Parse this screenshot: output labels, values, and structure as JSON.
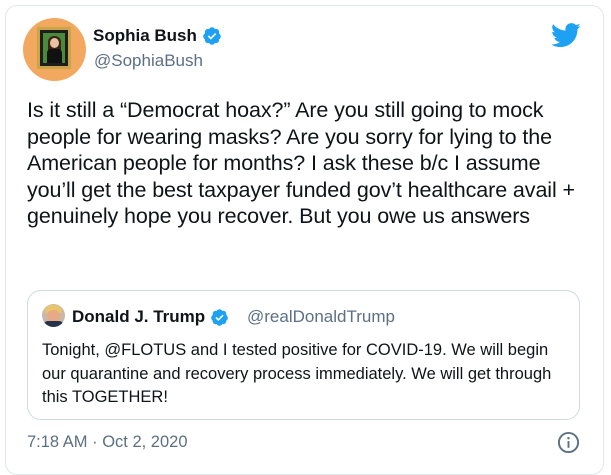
{
  "author": {
    "display_name": "Sophia Bush",
    "handle": "@SophiaBush",
    "verified": true
  },
  "tweet": {
    "text": "Is it still a “Democrat hoax?” Are you still going to mock people for wearing masks? Are you sorry for lying to the American people for months? I ask these b/c I assume you’ll get the best taxpayer funded gov’t healthcare avail + genuinely hope you recover. But you owe us answers",
    "timestamp": "7:18 AM · Oct 2, 2020"
  },
  "quoted_tweet": {
    "display_name": "Donald J. Trump",
    "handle": "@realDonaldTrump",
    "verified": true,
    "text": "Tonight, @FLOTUS and I tested positive for COVID-19. We will begin our quarantine and recovery process immediately. We will get through this TOGETHER!"
  },
  "icons": {
    "brand": "twitter-bird-icon",
    "verified": "verified-badge-icon",
    "info": "info-icon"
  },
  "colors": {
    "twitter_blue": "#1da1f2",
    "secondary_text": "#5b7083",
    "border": "#e1e8ed"
  }
}
